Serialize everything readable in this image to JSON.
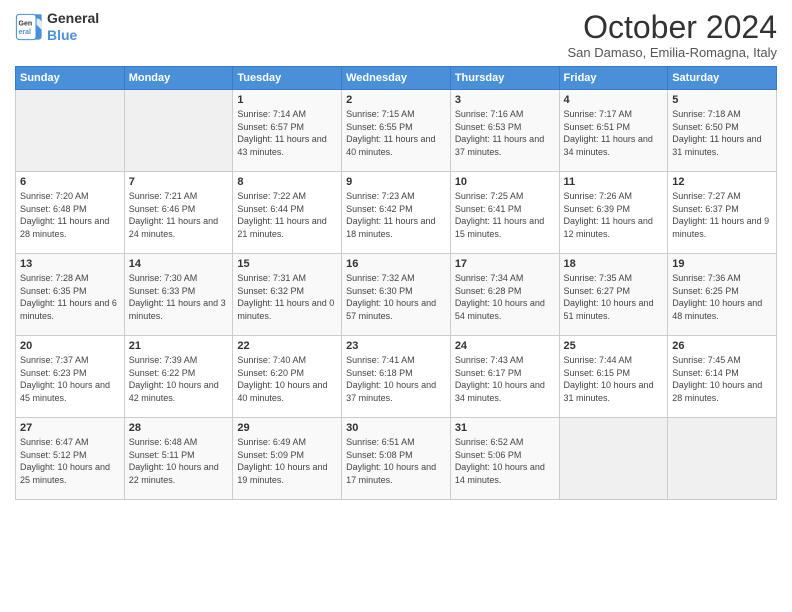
{
  "logo": {
    "line1": "General",
    "line2": "Blue"
  },
  "title": "October 2024",
  "subtitle": "San Damaso, Emilia-Romagna, Italy",
  "days_of_week": [
    "Sunday",
    "Monday",
    "Tuesday",
    "Wednesday",
    "Thursday",
    "Friday",
    "Saturday"
  ],
  "weeks": [
    [
      {
        "day": "",
        "info": ""
      },
      {
        "day": "",
        "info": ""
      },
      {
        "day": "1",
        "info": "Sunrise: 7:14 AM\nSunset: 6:57 PM\nDaylight: 11 hours and 43 minutes."
      },
      {
        "day": "2",
        "info": "Sunrise: 7:15 AM\nSunset: 6:55 PM\nDaylight: 11 hours and 40 minutes."
      },
      {
        "day": "3",
        "info": "Sunrise: 7:16 AM\nSunset: 6:53 PM\nDaylight: 11 hours and 37 minutes."
      },
      {
        "day": "4",
        "info": "Sunrise: 7:17 AM\nSunset: 6:51 PM\nDaylight: 11 hours and 34 minutes."
      },
      {
        "day": "5",
        "info": "Sunrise: 7:18 AM\nSunset: 6:50 PM\nDaylight: 11 hours and 31 minutes."
      }
    ],
    [
      {
        "day": "6",
        "info": "Sunrise: 7:20 AM\nSunset: 6:48 PM\nDaylight: 11 hours and 28 minutes."
      },
      {
        "day": "7",
        "info": "Sunrise: 7:21 AM\nSunset: 6:46 PM\nDaylight: 11 hours and 24 minutes."
      },
      {
        "day": "8",
        "info": "Sunrise: 7:22 AM\nSunset: 6:44 PM\nDaylight: 11 hours and 21 minutes."
      },
      {
        "day": "9",
        "info": "Sunrise: 7:23 AM\nSunset: 6:42 PM\nDaylight: 11 hours and 18 minutes."
      },
      {
        "day": "10",
        "info": "Sunrise: 7:25 AM\nSunset: 6:41 PM\nDaylight: 11 hours and 15 minutes."
      },
      {
        "day": "11",
        "info": "Sunrise: 7:26 AM\nSunset: 6:39 PM\nDaylight: 11 hours and 12 minutes."
      },
      {
        "day": "12",
        "info": "Sunrise: 7:27 AM\nSunset: 6:37 PM\nDaylight: 11 hours and 9 minutes."
      }
    ],
    [
      {
        "day": "13",
        "info": "Sunrise: 7:28 AM\nSunset: 6:35 PM\nDaylight: 11 hours and 6 minutes."
      },
      {
        "day": "14",
        "info": "Sunrise: 7:30 AM\nSunset: 6:33 PM\nDaylight: 11 hours and 3 minutes."
      },
      {
        "day": "15",
        "info": "Sunrise: 7:31 AM\nSunset: 6:32 PM\nDaylight: 11 hours and 0 minutes."
      },
      {
        "day": "16",
        "info": "Sunrise: 7:32 AM\nSunset: 6:30 PM\nDaylight: 10 hours and 57 minutes."
      },
      {
        "day": "17",
        "info": "Sunrise: 7:34 AM\nSunset: 6:28 PM\nDaylight: 10 hours and 54 minutes."
      },
      {
        "day": "18",
        "info": "Sunrise: 7:35 AM\nSunset: 6:27 PM\nDaylight: 10 hours and 51 minutes."
      },
      {
        "day": "19",
        "info": "Sunrise: 7:36 AM\nSunset: 6:25 PM\nDaylight: 10 hours and 48 minutes."
      }
    ],
    [
      {
        "day": "20",
        "info": "Sunrise: 7:37 AM\nSunset: 6:23 PM\nDaylight: 10 hours and 45 minutes."
      },
      {
        "day": "21",
        "info": "Sunrise: 7:39 AM\nSunset: 6:22 PM\nDaylight: 10 hours and 42 minutes."
      },
      {
        "day": "22",
        "info": "Sunrise: 7:40 AM\nSunset: 6:20 PM\nDaylight: 10 hours and 40 minutes."
      },
      {
        "day": "23",
        "info": "Sunrise: 7:41 AM\nSunset: 6:18 PM\nDaylight: 10 hours and 37 minutes."
      },
      {
        "day": "24",
        "info": "Sunrise: 7:43 AM\nSunset: 6:17 PM\nDaylight: 10 hours and 34 minutes."
      },
      {
        "day": "25",
        "info": "Sunrise: 7:44 AM\nSunset: 6:15 PM\nDaylight: 10 hours and 31 minutes."
      },
      {
        "day": "26",
        "info": "Sunrise: 7:45 AM\nSunset: 6:14 PM\nDaylight: 10 hours and 28 minutes."
      }
    ],
    [
      {
        "day": "27",
        "info": "Sunrise: 6:47 AM\nSunset: 5:12 PM\nDaylight: 10 hours and 25 minutes."
      },
      {
        "day": "28",
        "info": "Sunrise: 6:48 AM\nSunset: 5:11 PM\nDaylight: 10 hours and 22 minutes."
      },
      {
        "day": "29",
        "info": "Sunrise: 6:49 AM\nSunset: 5:09 PM\nDaylight: 10 hours and 19 minutes."
      },
      {
        "day": "30",
        "info": "Sunrise: 6:51 AM\nSunset: 5:08 PM\nDaylight: 10 hours and 17 minutes."
      },
      {
        "day": "31",
        "info": "Sunrise: 6:52 AM\nSunset: 5:06 PM\nDaylight: 10 hours and 14 minutes."
      },
      {
        "day": "",
        "info": ""
      },
      {
        "day": "",
        "info": ""
      }
    ]
  ]
}
